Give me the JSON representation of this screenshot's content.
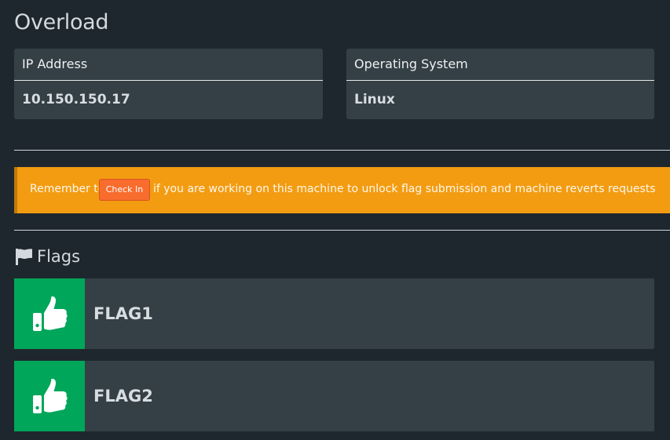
{
  "page": {
    "title": "Overload"
  },
  "info": {
    "ip_label": "IP Address",
    "ip_value": "10.150.150.17",
    "os_label": "Operating System",
    "os_value": "Linux"
  },
  "alert": {
    "text_before": "Remember to",
    "checkin_label": "Check In",
    "text_after": "if you are working on this machine to unlock flag submission and machine reverts requests"
  },
  "flags": {
    "heading": "Flags",
    "icon": "flag-icon",
    "items": [
      {
        "name": "FLAG1",
        "status_icon": "thumbs-up-icon"
      },
      {
        "name": "FLAG2",
        "status_icon": "thumbs-up-icon"
      }
    ]
  },
  "colors": {
    "background": "#1f272e",
    "card": "#343f46",
    "alert": "#f39c12",
    "checkin_button": "#f86c2e",
    "flag_success": "#00a65a"
  }
}
